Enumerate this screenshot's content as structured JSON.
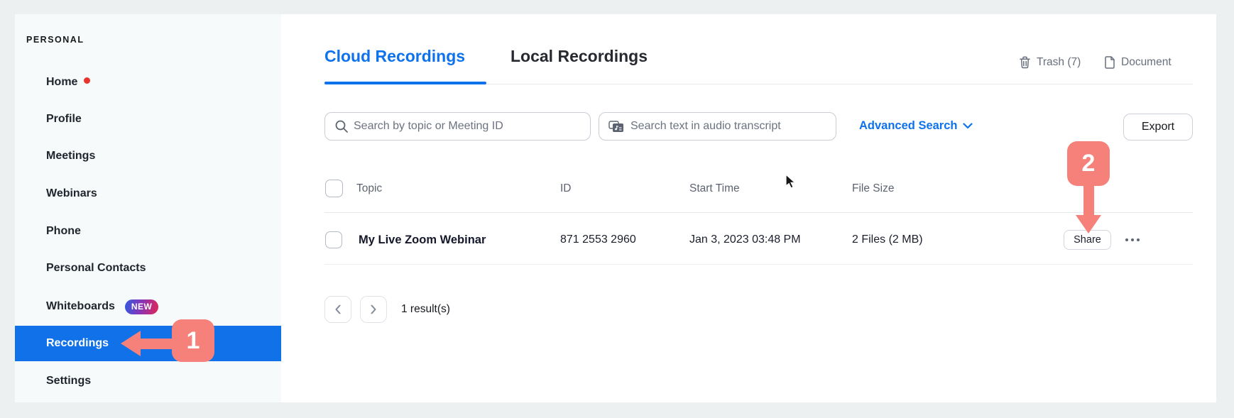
{
  "sidebar": {
    "section_label": "PERSONAL",
    "items": [
      {
        "label": "Home"
      },
      {
        "label": "Profile"
      },
      {
        "label": "Meetings"
      },
      {
        "label": "Webinars"
      },
      {
        "label": "Phone"
      },
      {
        "label": "Personal Contacts"
      },
      {
        "label": "Whiteboards",
        "badge": "NEW"
      },
      {
        "label": "Recordings"
      },
      {
        "label": "Settings"
      }
    ],
    "active_item": "Recordings"
  },
  "tabs": {
    "cloud": "Cloud Recordings",
    "local": "Local Recordings"
  },
  "header_links": {
    "trash": "Trash (7)",
    "document": "Document"
  },
  "search": {
    "topic_placeholder": "Search by topic or Meeting ID",
    "transcript_placeholder": "Search text in audio transcript",
    "advanced_label": "Advanced Search",
    "export_label": "Export"
  },
  "table": {
    "headers": [
      "Topic",
      "ID",
      "Start Time",
      "File Size"
    ],
    "rows": [
      {
        "topic": "My Live Zoom Webinar",
        "id": "871 2553 2960",
        "start_time": "Jan 3, 2023 03:48 PM",
        "file_size": "2 Files (2 MB)",
        "share_label": "Share"
      }
    ]
  },
  "pagination": {
    "results": "1 result(s)"
  },
  "callouts": {
    "step1": "1",
    "step2": "2"
  },
  "colors": {
    "accent_blue": "#0e72ed",
    "active_row_blue": "#1071e8",
    "callout_salmon": "#f5817a",
    "notification_red": "#e8342c",
    "badge_gradient_start": "#2e5be0",
    "badge_gradient_end": "#e22653"
  }
}
